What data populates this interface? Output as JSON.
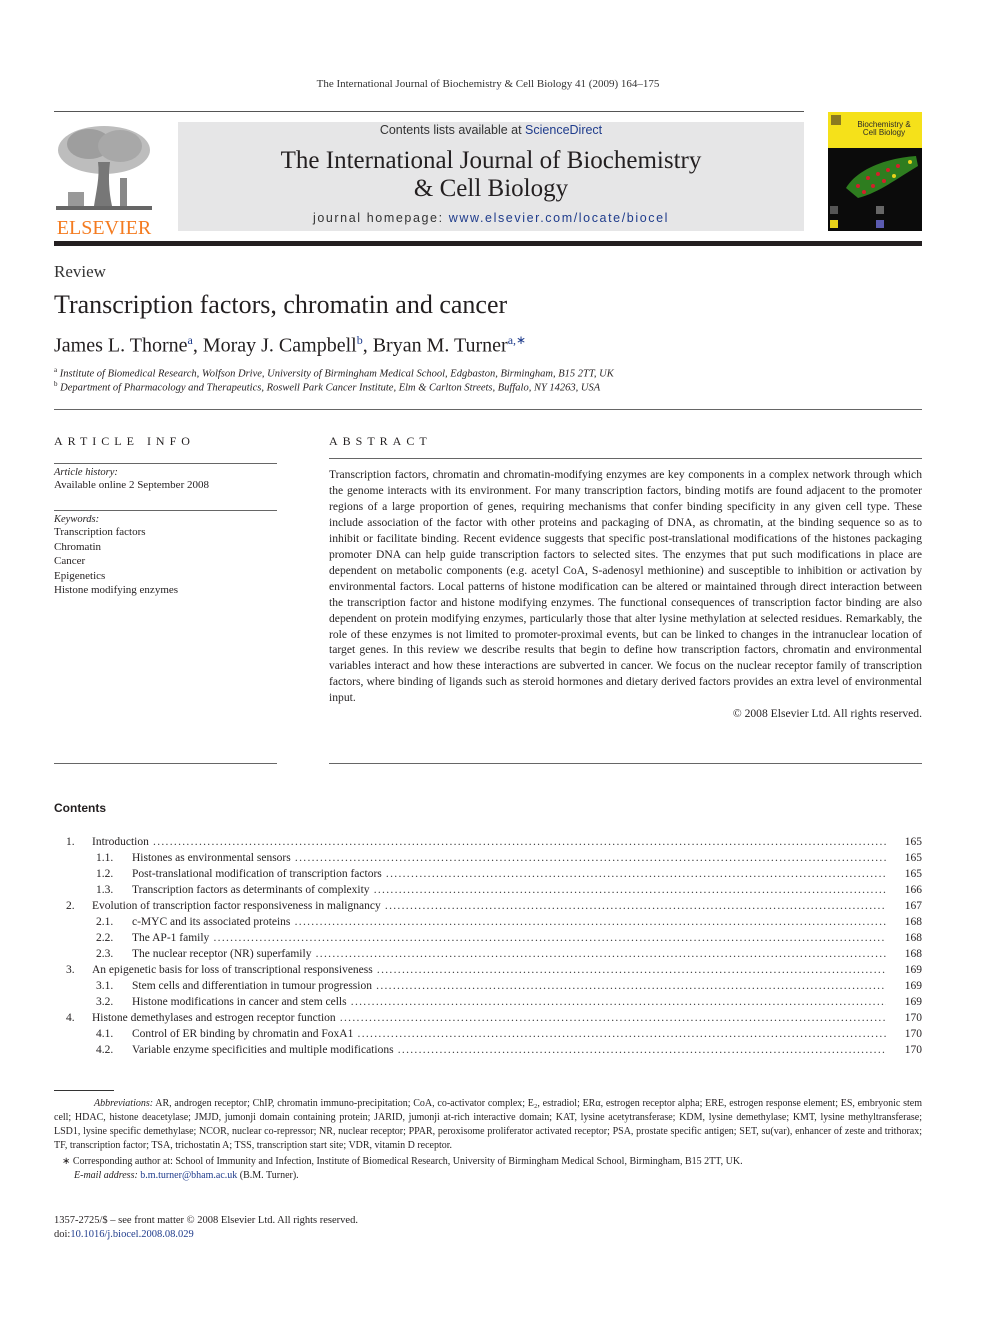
{
  "running_head": "The International Journal of Biochemistry & Cell Biology 41 (2009) 164–175",
  "masthead": {
    "publisher_logo_label": "ELSEVIER",
    "contents_available_prefix": "Contents lists available at ",
    "contents_available_link": "ScienceDirect",
    "journal_title_line1": "The International Journal of Biochemistry",
    "journal_title_line2": "& Cell Biology",
    "homepage_prefix": "journal homepage: ",
    "homepage_link": "www.elsevier.com/locate/biocel",
    "cover_title_line1": "Biochemistry &",
    "cover_title_line2": "Cell Biology",
    "brand_color": "#f47b20",
    "link_color": "#1f3c8c",
    "cover_color": "#f5e11a"
  },
  "article": {
    "type": "Review",
    "title": "Transcription factors, chromatin and cancer",
    "authors": [
      {
        "name": "James L. Thorne",
        "sup": "a"
      },
      {
        "name": "Moray J. Campbell",
        "sup": "b"
      },
      {
        "name": "Bryan M. Turner",
        "sup": "a,∗"
      }
    ],
    "affiliations": [
      {
        "label": "a",
        "text": "Institute of Biomedical Research, Wolfson Drive, University of Birmingham Medical School, Edgbaston, Birmingham, B15 2TT, UK"
      },
      {
        "label": "b",
        "text": "Department of Pharmacology and Therapeutics, Roswell Park Cancer Institute, Elm & Carlton Streets, Buffalo, NY 14263, USA"
      }
    ]
  },
  "article_info": {
    "heading": "ARTICLE INFO",
    "history_label": "Article history:",
    "history_value": "Available online 2 September 2008",
    "keywords_label": "Keywords:",
    "keywords": [
      "Transcription factors",
      "Chromatin",
      "Cancer",
      "Epigenetics",
      "Histone modifying enzymes"
    ]
  },
  "abstract": {
    "heading": "ABSTRACT",
    "text": "Transcription factors, chromatin and chromatin-modifying enzymes are key components in a complex network through which the genome interacts with its environment. For many transcription factors, binding motifs are found adjacent to the promoter regions of a large proportion of genes, requiring mechanisms that confer binding specificity in any given cell type. These include association of the factor with other proteins and packaging of DNA, as chromatin, at the binding sequence so as to inhibit or facilitate binding. Recent evidence suggests that specific post-translational modifications of the histones packaging promoter DNA can help guide transcription factors to selected sites. The enzymes that put such modifications in place are dependent on metabolic components (e.g. acetyl CoA, S-adenosyl methionine) and susceptible to inhibition or activation by environmental factors. Local patterns of histone modification can be altered or maintained through direct interaction between the transcription factor and histone modifying enzymes. The functional consequences of transcription factor binding are also dependent on protein modifying enzymes, particularly those that alter lysine methylation at selected residues. Remarkably, the role of these enzymes is not limited to promoter-proximal events, but can be linked to changes in the intranuclear location of target genes. In this review we describe results that begin to define how transcription factors, chromatin and environmental variables interact and how these interactions are subverted in cancer. We focus on the nuclear receptor family of transcription factors, where binding of ligands such as steroid hormones and dietary derived factors provides an extra level of environmental input.",
    "copyright": "© 2008 Elsevier Ltd. All rights reserved."
  },
  "contents": {
    "heading": "Contents",
    "entries": [
      {
        "num": "1.",
        "title": "Introduction",
        "page": "165",
        "level": 1
      },
      {
        "num": "1.1.",
        "title": "Histones as environmental sensors",
        "page": "165",
        "level": 2
      },
      {
        "num": "1.2.",
        "title": "Post-translational modification of transcription factors",
        "page": "165",
        "level": 2
      },
      {
        "num": "1.3.",
        "title": "Transcription factors as determinants of complexity",
        "page": "166",
        "level": 2
      },
      {
        "num": "2.",
        "title": "Evolution of transcription factor responsiveness in malignancy",
        "page": "167",
        "level": 1
      },
      {
        "num": "2.1.",
        "title": "c-MYC and its associated proteins",
        "page": "168",
        "level": 2
      },
      {
        "num": "2.2.",
        "title": "The AP-1 family",
        "page": "168",
        "level": 2
      },
      {
        "num": "2.3.",
        "title": "The nuclear receptor (NR) superfamily",
        "page": "168",
        "level": 2
      },
      {
        "num": "3.",
        "title": "An epigenetic basis for loss of transcriptional responsiveness",
        "page": "169",
        "level": 1
      },
      {
        "num": "3.1.",
        "title": "Stem cells and differentiation in tumour progression",
        "page": "169",
        "level": 2
      },
      {
        "num": "3.2.",
        "title": "Histone modifications in cancer and stem cells",
        "page": "169",
        "level": 2
      },
      {
        "num": "4.",
        "title": "Histone demethylases and estrogen receptor function",
        "page": "170",
        "level": 1
      },
      {
        "num": "4.1.",
        "title": "Control of ER binding by chromatin and FoxA1",
        "page": "170",
        "level": 2
      },
      {
        "num": "4.2.",
        "title": "Variable enzyme specificities and multiple modifications",
        "page": "170",
        "level": 2
      }
    ]
  },
  "footnotes": {
    "abbreviations_label": "Abbreviations:",
    "abbreviations_text": "AR, androgen receptor; ChIP, chromatin immuno-precipitation; CoA, co-activator complex; E₂, estradiol; ERα, estrogen receptor alpha; ERE, estrogen response element; ES, embryonic stem cell; HDAC, histone deacetylase; JMJD, jumonji domain containing protein; JARID, jumonji at-rich interactive domain; KAT, lysine acetytransferase; KDM, lysine demethylase; KMT, lysine methyltransferase; LSD1, lysine specific demethylase; NCOR, nuclear co-repressor; NR, nuclear receptor; PPAR, peroxisome proliferator activated receptor; PSA, prostate specific antigen; SET, su(var), enhancer of zeste and trithorax; TF, transcription factor; TSA, trichostatin A; TSS, transcription start site; VDR, vitamin D receptor.",
    "corresponding_mark": "∗",
    "corresponding_text": "Corresponding author at: School of Immunity and Infection, Institute of Biomedical Research, University of Birmingham Medical School, Birmingham, B15 2TT, UK.",
    "email_label": "E-mail address:",
    "email": "b.m.turner@bham.ac.uk",
    "email_suffix": "(B.M. Turner)."
  },
  "bottom": {
    "issn_line": "1357-2725/$ – see front matter © 2008 Elsevier Ltd. All rights reserved.",
    "doi_prefix": "doi:",
    "doi": "10.1016/j.biocel.2008.08.029"
  }
}
